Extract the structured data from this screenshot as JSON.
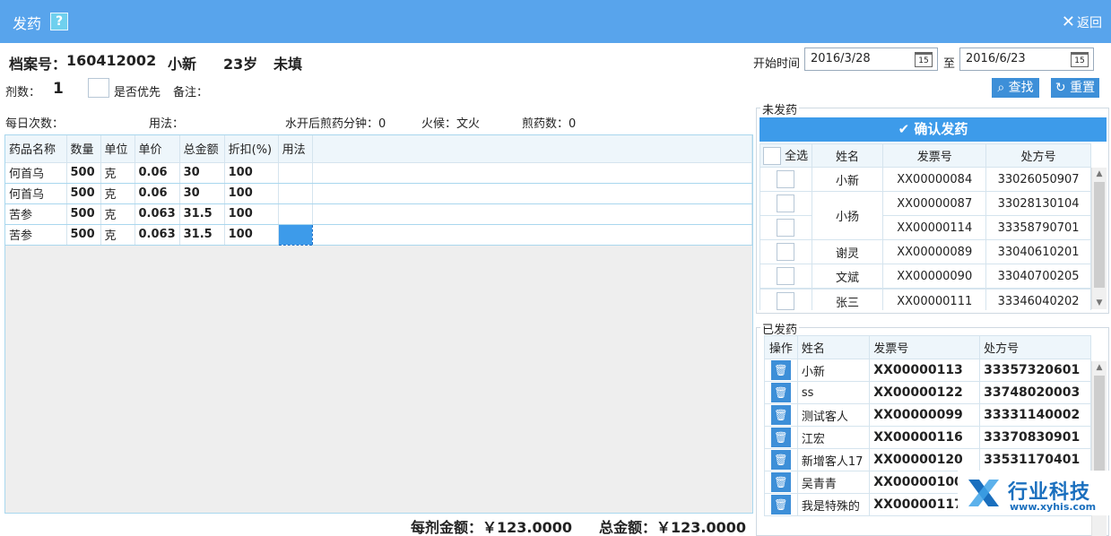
{
  "window": {
    "title": "发药",
    "help": "?",
    "back": "返回"
  },
  "patient": {
    "file_label": "档案号：",
    "file_no": "160412002",
    "name": "小新",
    "age": "23岁",
    "status": "未填"
  },
  "dose": {
    "label": "剂数：",
    "value": "1",
    "priority_label": "是否优先",
    "remark_label": "备注："
  },
  "info": {
    "daily_times": "每日次数：",
    "usage": "用法：",
    "boil": "水开后煎药分钟：0",
    "fire": "火候：文火",
    "decoct": "煎药数：0"
  },
  "rx_table": {
    "headers": [
      "药品名称",
      "数量",
      "单位",
      "单价",
      "总金额",
      "折扣(%)",
      "用法"
    ],
    "rows": [
      [
        "何首乌",
        "500",
        "克",
        "0.06",
        "30",
        "100",
        ""
      ],
      [
        "何首乌",
        "500",
        "克",
        "0.06",
        "30",
        "100",
        ""
      ],
      [
        "苦参",
        "500",
        "克",
        "0.063",
        "31.5",
        "100",
        ""
      ],
      [
        "苦参",
        "500",
        "克",
        "0.063",
        "31.5",
        "100",
        ""
      ]
    ]
  },
  "totals": {
    "per_dose": "每剂金额：￥123.0000",
    "total": "总金额：￥123.0000"
  },
  "search": {
    "start_label": "开始时间",
    "start_date": "2016/3/28",
    "to_label": "至",
    "end_date": "2016/6/23",
    "cal_day": "15",
    "find": "查找",
    "reset": "重置"
  },
  "pending": {
    "label": "未发药",
    "confirm": "确认发药",
    "select_all": "全选",
    "headers": [
      "姓名",
      "发票号",
      "处方号"
    ],
    "rows": [
      {
        "name": "小新",
        "invoice": "XX00000084",
        "rx": "33026050907"
      },
      {
        "name": "小扬",
        "invoice": "XX00000087",
        "rx": "33028130104"
      },
      {
        "name": "",
        "invoice": "XX00000114",
        "rx": "33358790701"
      },
      {
        "name": "谢灵",
        "invoice": "XX00000089",
        "rx": "33040610201"
      },
      {
        "name": "文斌",
        "invoice": "XX00000090",
        "rx": "33040700205"
      },
      {
        "name": "张三",
        "invoice": "XX00000111",
        "rx": "33346040202"
      }
    ]
  },
  "dispensed": {
    "label": "已发药",
    "headers": [
      "操作",
      "姓名",
      "发票号",
      "处方号"
    ],
    "rows": [
      {
        "name": "小新",
        "invoice": "XX00000113",
        "rx": "33357320601"
      },
      {
        "name": "ss",
        "invoice": "XX00000122",
        "rx": "33748020003"
      },
      {
        "name": "测试客人",
        "invoice": "XX00000099",
        "rx": "33331140002"
      },
      {
        "name": "江宏",
        "invoice": "XX00000116",
        "rx": "33370830901"
      },
      {
        "name": "新增客人17",
        "invoice": "XX00000120",
        "rx": "33531170401"
      },
      {
        "name": "吴青青",
        "invoice": "XX00000100",
        "rx": ""
      },
      {
        "name": "我是特殊的",
        "invoice": "XX00000117",
        "rx": ""
      }
    ]
  },
  "watermark": {
    "name": "行业科技",
    "url": "www.xyhis.com"
  },
  "colors": {
    "titlebar": "#58a4ec",
    "accent": "#3d9bea",
    "button": "#3d8fd8"
  }
}
